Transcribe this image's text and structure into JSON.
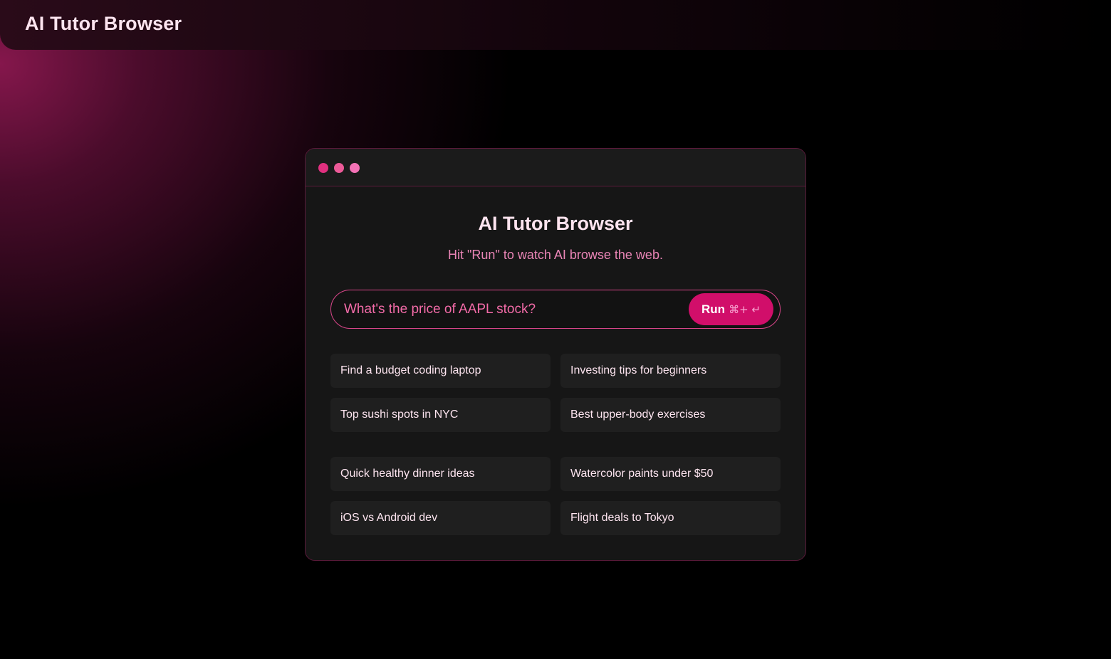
{
  "app": {
    "title": "AI Tutor Browser"
  },
  "window": {
    "heading": "AI Tutor Browser",
    "subheading": "Hit \"Run\" to watch AI browse the web."
  },
  "search": {
    "value": "What's the price of AAPL stock?",
    "placeholder": "What's the price of AAPL stock?",
    "run_label": "Run",
    "run_shortcut": "⌘+ ↵"
  },
  "suggestions": [
    {
      "label": "Find a budget coding laptop"
    },
    {
      "label": "Investing tips for beginners"
    },
    {
      "label": "Top sushi spots in NYC"
    },
    {
      "label": "Best upper-body exercises"
    },
    {
      "label": "Quick healthy dinner ideas"
    },
    {
      "label": "Watercolor paints under $50"
    },
    {
      "label": "iOS vs Android dev"
    },
    {
      "label": "Flight deals to Tokyo"
    }
  ],
  "colors": {
    "accent": "#d10e6a",
    "accent_text": "#f36ba8",
    "window_dots": [
      "#e0307f",
      "#ec5a98",
      "#f472b6"
    ]
  }
}
